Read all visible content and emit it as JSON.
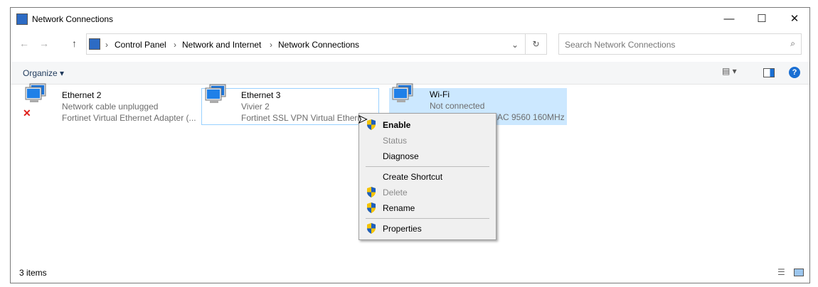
{
  "window": {
    "title": "Network Connections",
    "minimize": "—",
    "maximize": "☐",
    "close": "✕"
  },
  "address": {
    "crumbs": [
      "Control Panel",
      "Network and Internet",
      "Network Connections"
    ],
    "separator": "›"
  },
  "search": {
    "placeholder": "Search Network Connections"
  },
  "toolbar": {
    "organize": "Organize ▾",
    "help": "?"
  },
  "items": [
    {
      "name": "Ethernet 2",
      "status": "Network cable unplugged",
      "device": "Fortinet Virtual Ethernet Adapter (..."
    },
    {
      "name": "Ethernet 3",
      "status": "Vivier 2",
      "device": "Fortinet SSL VPN Virtual Etherne"
    },
    {
      "name": "Wi-Fi",
      "status": "Not connected",
      "device": "AC 9560 160MHz"
    }
  ],
  "context_menu": {
    "items": [
      {
        "label": "Enable",
        "bold": true,
        "shield": true
      },
      {
        "label": "Status",
        "disabled": true
      },
      {
        "label": "Diagnose"
      },
      {
        "label": "Create Shortcut"
      },
      {
        "label": "Delete",
        "disabled": true,
        "shield": true
      },
      {
        "label": "Rename",
        "shield": true
      },
      {
        "label": "Properties",
        "shield": true
      }
    ]
  },
  "statusbar": {
    "count": "3 items"
  },
  "colors": {
    "selection": "#cce8ff",
    "selection_border": "#99d1ff",
    "accent": "#1a6fd3"
  }
}
